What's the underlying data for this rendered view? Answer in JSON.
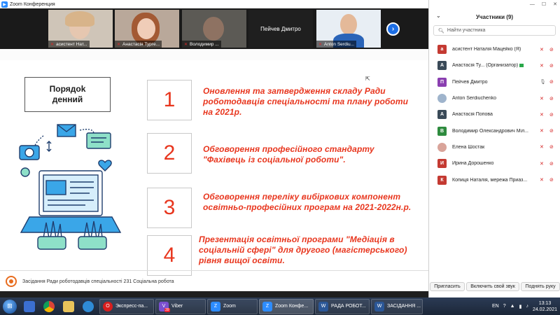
{
  "window": {
    "title": "Zoom Конференция"
  },
  "videos": [
    {
      "label": "асистент Нат...",
      "muted": true
    },
    {
      "label": "Анастасія Турге...",
      "muted": true
    },
    {
      "label": "Володимир ...",
      "muted": true
    },
    {
      "label": "Пейчев Дмитро",
      "muted": false
    },
    {
      "label": "Anton Serdiu...",
      "muted": true
    }
  ],
  "slide": {
    "agenda_title_line1": "Порядоk",
    "agenda_title_line2": "денний",
    "items": [
      {
        "number": "1",
        "text": "Оновлення та затвердження складу Ради роботодавців спеціальності та плану роботи на 2021р."
      },
      {
        "number": "2",
        "text": "Обговорення професійного стандарту \"Фахівець із соціальної роботи\"."
      },
      {
        "number": "3",
        "text": "Обговорення переліку вибіркових компонент освітньо-професійних програм на 2021-2022н.р."
      },
      {
        "number": "4",
        "text": "Презентація освітньої програми \"Медіація в соціальній сфері\" для другого (магістерського) рівня вищої освіти."
      }
    ],
    "footer": "Засідання Ради роботодавців спеціальності 231 Соціальна робота"
  },
  "participants": {
    "title": "Участники (9)",
    "search_placeholder": "Найти участника",
    "list": [
      {
        "initial": "а",
        "name": "асистент Наталія Мацейко (Я)",
        "color": "#c43a32",
        "mic": "muted",
        "cam": "off"
      },
      {
        "initial": "А",
        "name": "Анастасія Ту... (Организатор)",
        "color": "#3a4a58",
        "mic": "muted",
        "cam": "off",
        "host": true
      },
      {
        "initial": "П",
        "name": "Пейчев Дмитро",
        "color": "#8a3fb0",
        "mic": "on",
        "cam": "off"
      },
      {
        "initial": "",
        "name": "Anton Serdiuchenko",
        "color": "#cccccc",
        "photo": true,
        "mic": "muted",
        "cam": "off"
      },
      {
        "initial": "А",
        "name": "Анастасія Попова",
        "color": "#3a4a58",
        "mic": "muted",
        "cam": "off"
      },
      {
        "initial": "В",
        "name": "Володимир Олександрович Міл...",
        "color": "#2e8b3e",
        "mic": "muted",
        "cam": "off"
      },
      {
        "initial": "",
        "name": "Елена Шостак",
        "color": "#e0b6b0",
        "photo": true,
        "mic": "muted",
        "cam": "off"
      },
      {
        "initial": "И",
        "name": "Ирина Дорошенко",
        "color": "#c43a32",
        "mic": "muted",
        "cam": "off"
      },
      {
        "initial": "К",
        "name": "Копиця Наталія, мережа Приаз...",
        "color": "#c43a32",
        "mic": "muted",
        "cam": "off"
      }
    ],
    "invite_label": "Пригласить",
    "unmute_label": "Включить свой звук",
    "raise_label": "Поднять руку"
  },
  "taskbar": {
    "items": [
      {
        "label": "Экспресс-па...",
        "color": "#d81e1e",
        "glyph": "O"
      },
      {
        "label": "Viber",
        "color": "#7a4fd0",
        "glyph": "V",
        "badge": "39"
      },
      {
        "label": "Zoom",
        "color": "#2d8cff",
        "glyph": "Z"
      },
      {
        "label": "Zoom Конфе...",
        "color": "#2d8cff",
        "glyph": "Z"
      },
      {
        "label": "РАДА РОБОТ...",
        "color": "#2b5797",
        "glyph": "W"
      },
      {
        "label": "ЗАСІДАННЯ ...",
        "color": "#2b5797",
        "glyph": "W"
      }
    ],
    "lang": "EN",
    "time": "13:13",
    "date": "24.02.2021"
  }
}
